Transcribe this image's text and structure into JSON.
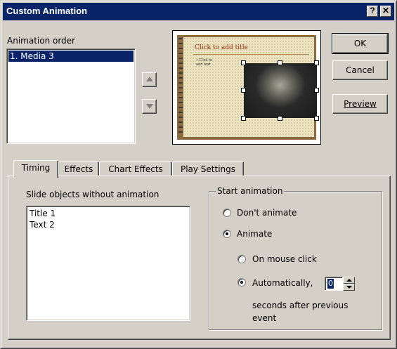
{
  "window": {
    "title": "Custom Animation",
    "help_label": "?",
    "close_label": "✕"
  },
  "animation_order": {
    "label": "Animation order",
    "items": [
      "1. Media 3"
    ]
  },
  "preview_slide": {
    "title_placeholder": "Click to add title",
    "text_placeholder_1": "• Click to",
    "text_placeholder_2": "add text"
  },
  "buttons": {
    "ok": "OK",
    "cancel": "Cancel",
    "preview": "Preview",
    "move_up_icon": "up-arrow-icon",
    "move_down_icon": "down-arrow-icon"
  },
  "tabs": [
    {
      "label": "Timing",
      "active": true
    },
    {
      "label": "Effects"
    },
    {
      "label": "Chart Effects"
    },
    {
      "label": "Play Settings"
    }
  ],
  "timing": {
    "objects_label": "Slide objects without animation",
    "objects": [
      "Title 1",
      "Text 2"
    ],
    "start_group_label": "Start animation",
    "dont_animate": "Don't animate",
    "animate": "Animate",
    "on_mouse_click": "On mouse click",
    "automatically": "Automatically,",
    "seconds_value": "0",
    "seconds_line1": "seconds after previous",
    "seconds_line2": "event",
    "selected_start": "animate",
    "selected_trigger": "automatically"
  },
  "colors": {
    "selection": "#0a246a",
    "dialog_bg": "#d4d0c8"
  }
}
